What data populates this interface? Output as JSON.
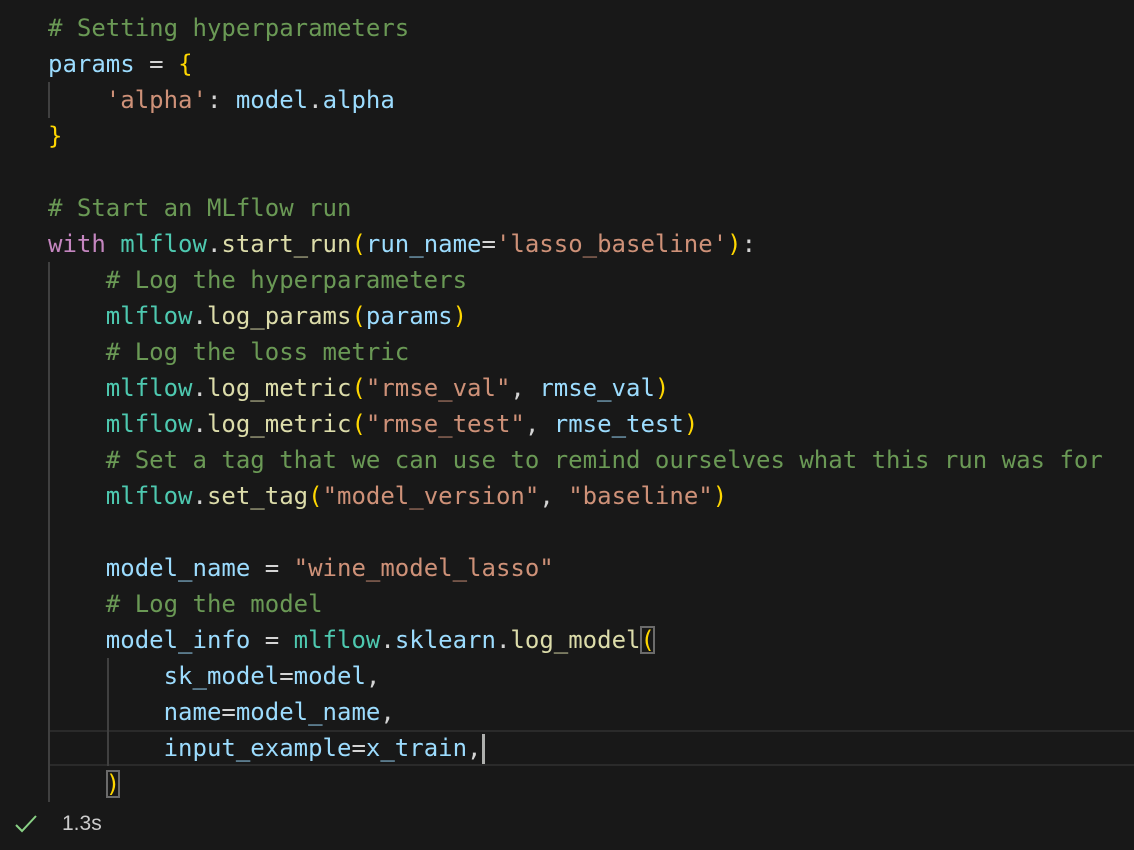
{
  "cell": {
    "lines": [
      [
        [
          "c",
          "# Setting hyperparameters"
        ]
      ],
      [
        [
          "v",
          "params"
        ],
        [
          "p",
          " = "
        ],
        [
          "b",
          "{"
        ]
      ],
      [
        [
          "p",
          "    "
        ],
        [
          "s",
          "'alpha'"
        ],
        [
          "p",
          ": "
        ],
        [
          "v",
          "model"
        ],
        [
          "p",
          "."
        ],
        [
          "v",
          "alpha"
        ]
      ],
      [
        [
          "b",
          "}"
        ]
      ],
      [],
      [
        [
          "c",
          "# Start an MLflow run"
        ]
      ],
      [
        [
          "k",
          "with"
        ],
        [
          "p",
          " "
        ],
        [
          "m",
          "mlflow"
        ],
        [
          "p",
          "."
        ],
        [
          "f",
          "start_run"
        ],
        [
          "b",
          "("
        ],
        [
          "v",
          "run_name"
        ],
        [
          "p",
          "="
        ],
        [
          "s",
          "'lasso_baseline'"
        ],
        [
          "b",
          ")"
        ],
        [
          "p",
          ":"
        ]
      ],
      [
        [
          "p",
          "    "
        ],
        [
          "c",
          "# Log the hyperparameters"
        ]
      ],
      [
        [
          "p",
          "    "
        ],
        [
          "m",
          "mlflow"
        ],
        [
          "p",
          "."
        ],
        [
          "f",
          "log_params"
        ],
        [
          "b",
          "("
        ],
        [
          "v",
          "params"
        ],
        [
          "b",
          ")"
        ]
      ],
      [
        [
          "p",
          "    "
        ],
        [
          "c",
          "# Log the loss metric"
        ]
      ],
      [
        [
          "p",
          "    "
        ],
        [
          "m",
          "mlflow"
        ],
        [
          "p",
          "."
        ],
        [
          "f",
          "log_metric"
        ],
        [
          "b",
          "("
        ],
        [
          "s",
          "\"rmse_val\""
        ],
        [
          "p",
          ", "
        ],
        [
          "v",
          "rmse_val"
        ],
        [
          "b",
          ")"
        ]
      ],
      [
        [
          "p",
          "    "
        ],
        [
          "m",
          "mlflow"
        ],
        [
          "p",
          "."
        ],
        [
          "f",
          "log_metric"
        ],
        [
          "b",
          "("
        ],
        [
          "s",
          "\"rmse_test\""
        ],
        [
          "p",
          ", "
        ],
        [
          "v",
          "rmse_test"
        ],
        [
          "b",
          ")"
        ]
      ],
      [
        [
          "p",
          "    "
        ],
        [
          "c",
          "# Set a tag that we can use to remind ourselves what this run was for"
        ]
      ],
      [
        [
          "p",
          "    "
        ],
        [
          "m",
          "mlflow"
        ],
        [
          "p",
          "."
        ],
        [
          "f",
          "set_tag"
        ],
        [
          "b",
          "("
        ],
        [
          "s",
          "\"model_version\""
        ],
        [
          "p",
          ", "
        ],
        [
          "s",
          "\"baseline\""
        ],
        [
          "b",
          ")"
        ]
      ],
      [],
      [
        [
          "p",
          "    "
        ],
        [
          "v",
          "model_name"
        ],
        [
          "p",
          " = "
        ],
        [
          "s",
          "\"wine_model_lasso\""
        ]
      ],
      [
        [
          "p",
          "    "
        ],
        [
          "c",
          "# Log the model"
        ]
      ],
      [
        [
          "p",
          "    "
        ],
        [
          "v",
          "model_info"
        ],
        [
          "p",
          " = "
        ],
        [
          "m",
          "mlflow"
        ],
        [
          "p",
          "."
        ],
        [
          "v",
          "sklearn"
        ],
        [
          "p",
          "."
        ],
        [
          "f",
          "log_model"
        ],
        [
          "b match",
          "("
        ]
      ],
      [
        [
          "p",
          "        "
        ],
        [
          "v",
          "sk_model"
        ],
        [
          "p",
          "="
        ],
        [
          "v",
          "model"
        ],
        [
          "p",
          ","
        ]
      ],
      [
        [
          "p",
          "        "
        ],
        [
          "v",
          "name"
        ],
        [
          "p",
          "="
        ],
        [
          "v",
          "model_name"
        ],
        [
          "p",
          ","
        ]
      ],
      [
        [
          "p",
          "        "
        ],
        [
          "v",
          "input_example"
        ],
        [
          "p",
          "="
        ],
        [
          "v",
          "x_train"
        ],
        [
          "p",
          ","
        ]
      ],
      [
        [
          "p",
          "    "
        ],
        [
          "b match",
          ")"
        ]
      ]
    ],
    "cursor_line": 20
  },
  "status": {
    "icon": "check-icon",
    "color": "#89D185",
    "duration": "1.3s"
  }
}
